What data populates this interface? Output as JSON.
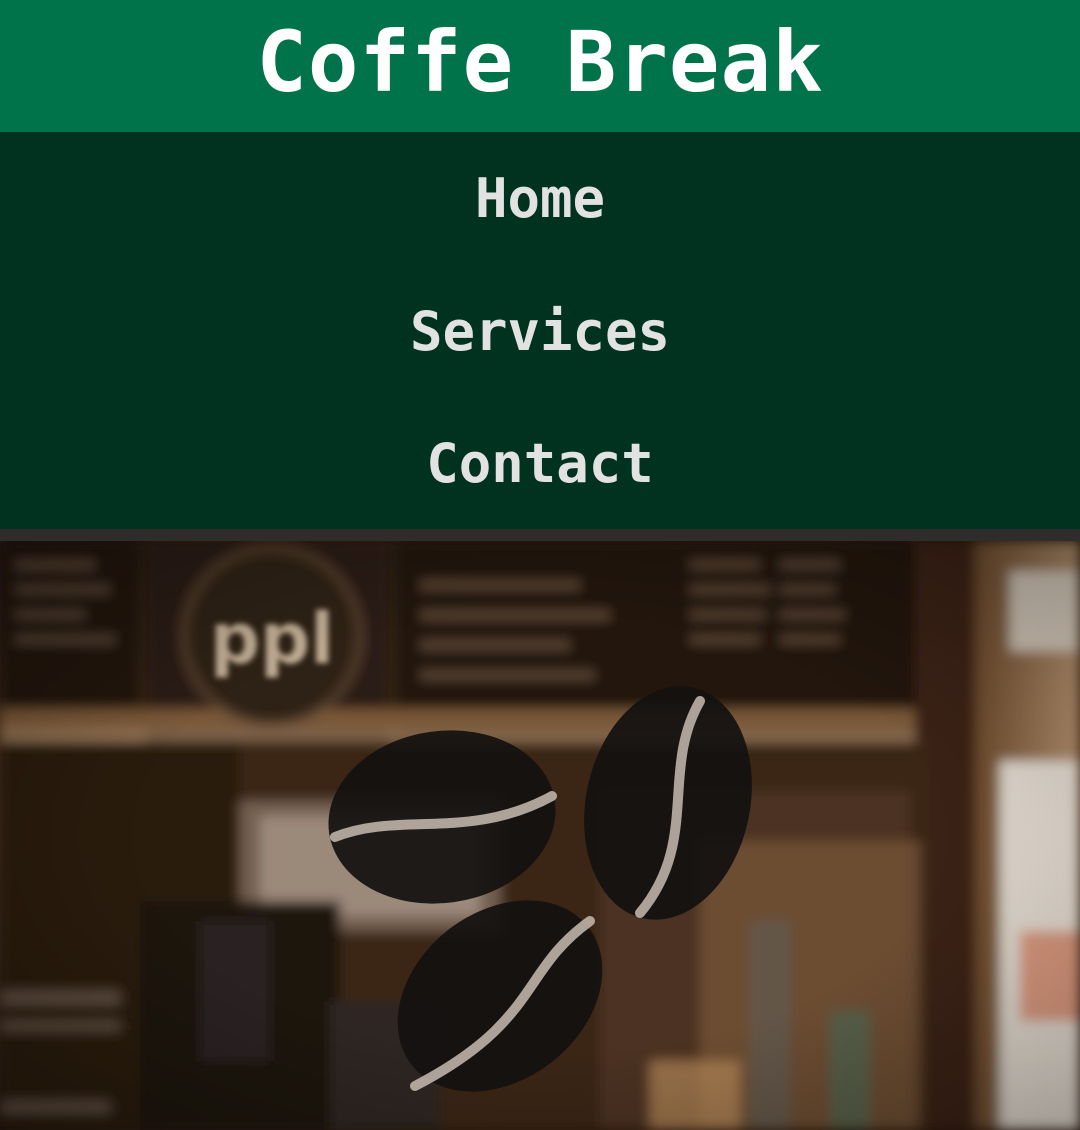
{
  "header": {
    "title": "Coffe Break"
  },
  "nav": {
    "items": [
      {
        "label": "Home"
      },
      {
        "label": "Services"
      },
      {
        "label": "Contact"
      }
    ]
  },
  "hero": {
    "background_icon": "blurred-cafe-photo",
    "logo_icon": "coffee-beans-icon",
    "sign_text": "ppl"
  },
  "colors": {
    "header_bg": "#00734b",
    "nav_bg": "#003220",
    "nav_text": "#e2e2e2",
    "title_text": "#ffffff"
  }
}
